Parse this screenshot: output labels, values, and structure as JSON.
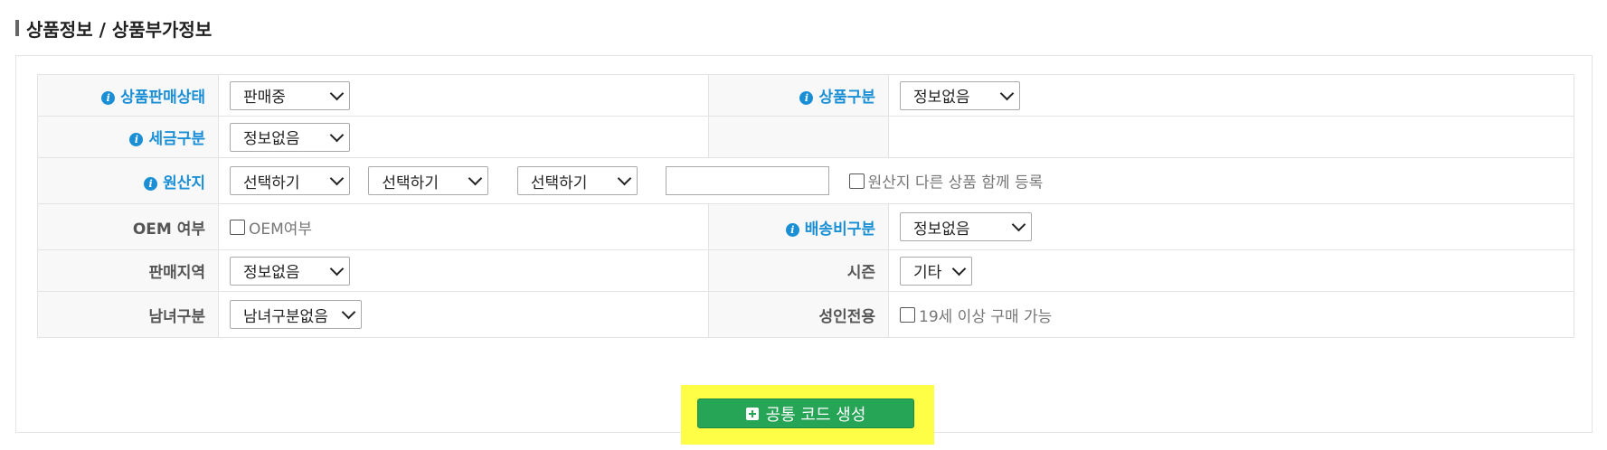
{
  "header": {
    "title": "상품정보 / 상품부가정보"
  },
  "form": {
    "sale_status": {
      "label": "상품판매상태",
      "value": "판매중"
    },
    "product_type": {
      "label": "상품구분",
      "value": "정보없음"
    },
    "tax_type": {
      "label": "세금구분",
      "value": "정보없음"
    },
    "origin": {
      "label": "원산지",
      "select1": "선택하기",
      "select2": "선택하기",
      "select3": "선택하기",
      "text_value": "",
      "checkbox_label": "원산지 다른 상품 함께 등록"
    },
    "oem": {
      "label": "OEM 여부",
      "checkbox_label": "OEM여부"
    },
    "shipping_type": {
      "label": "배송비구분",
      "value": "정보없음"
    },
    "sales_region": {
      "label": "판매지역",
      "value": "정보없음"
    },
    "season": {
      "label": "시즌",
      "value": "기타"
    },
    "gender": {
      "label": "남녀구분",
      "value": "남녀구분없음"
    },
    "adult_only": {
      "label": "성인전용",
      "checkbox_label": "19세 이상 구매 가능"
    }
  },
  "actions": {
    "generate_label": "공통 코드 생성"
  },
  "colors": {
    "required_label": "#1a8fd6",
    "button": "#27a556",
    "highlight": "#fefe47"
  }
}
